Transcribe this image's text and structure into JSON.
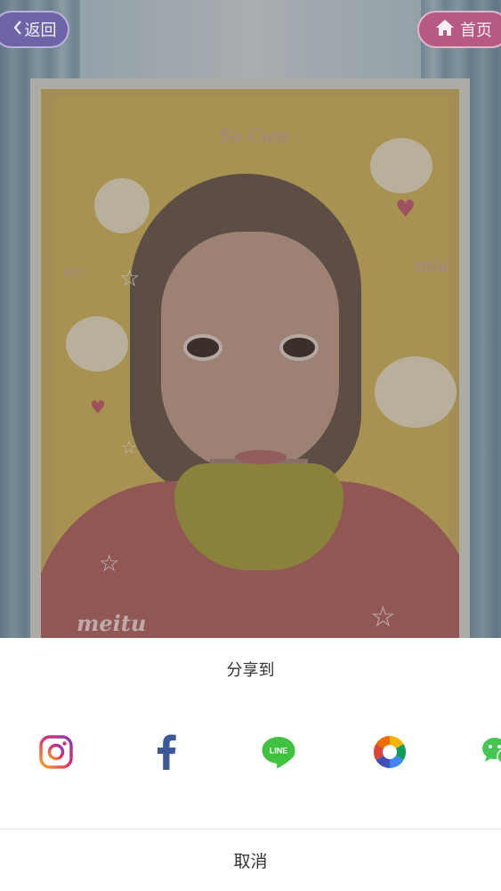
{
  "header": {
    "back_label": "返回",
    "home_label": "首页"
  },
  "photo": {
    "bubble_text": "So Cute",
    "bubble_text_2": "miu",
    "side_text": "PU",
    "brand_text": "meitu"
  },
  "share_sheet": {
    "title": "分享到",
    "targets": [
      {
        "name": "instagram",
        "icon": "instagram-icon"
      },
      {
        "name": "facebook",
        "icon": "facebook-icon"
      },
      {
        "name": "line",
        "icon": "line-icon",
        "label": "LINE"
      },
      {
        "name": "photos",
        "icon": "photos-icon"
      },
      {
        "name": "wechat",
        "icon": "wechat-icon"
      }
    ],
    "cancel_label": "取消"
  },
  "colors": {
    "instagram_gradient": [
      "#f5a623",
      "#e1306c",
      "#833ab4"
    ],
    "facebook": "#3b5998",
    "line": "#3fc23f",
    "wechat": "#44c650",
    "back_button": "#6f63a8",
    "home_button": "#b65a83"
  }
}
